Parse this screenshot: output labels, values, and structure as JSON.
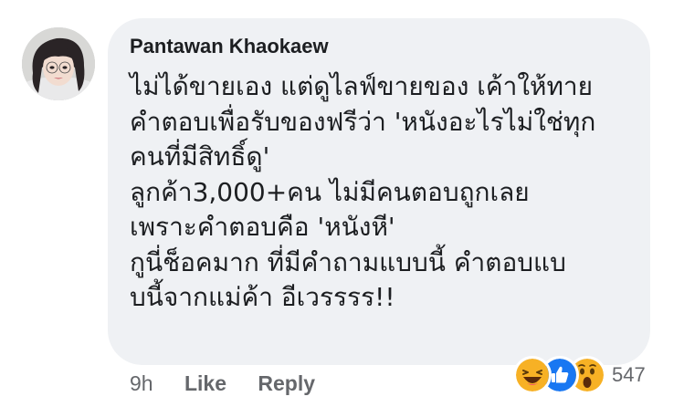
{
  "comment": {
    "author": "Pantawan Khaokaew",
    "lines": [
      "ไม่ได้ขายเอง แต่ดูไลฟ์ขายของ เค้าให้ทาย",
      "คำตอบเพื่อรับของฟรีว่า 'หนังอะไรไม่ใช่ทุก",
      "คนที่มีสิทธิ์ดู'",
      "ลูกค้า3,000+คน ไม่มีคนตอบถูกเลย",
      "เพราะคำตอบคือ 'หนังหี'",
      "กูนี่ช็อคมาก ที่มีคำถามแบบนี้ คำตอบแบ",
      "บนี้จากแม่ค้า อีเวรรรร!!"
    ]
  },
  "footer": {
    "timestamp": "9h",
    "like_label": "Like",
    "reply_label": "Reply"
  },
  "reactions": {
    "icons": [
      "haha-reaction-icon",
      "like-reaction-icon",
      "wow-reaction-icon"
    ],
    "count": "547"
  },
  "colors": {
    "bubble": "#eff1f4",
    "text": "#1c1e21",
    "meta": "#65676b",
    "like_blue": "#1877f2",
    "emoji_yellow": "#f7b125"
  }
}
